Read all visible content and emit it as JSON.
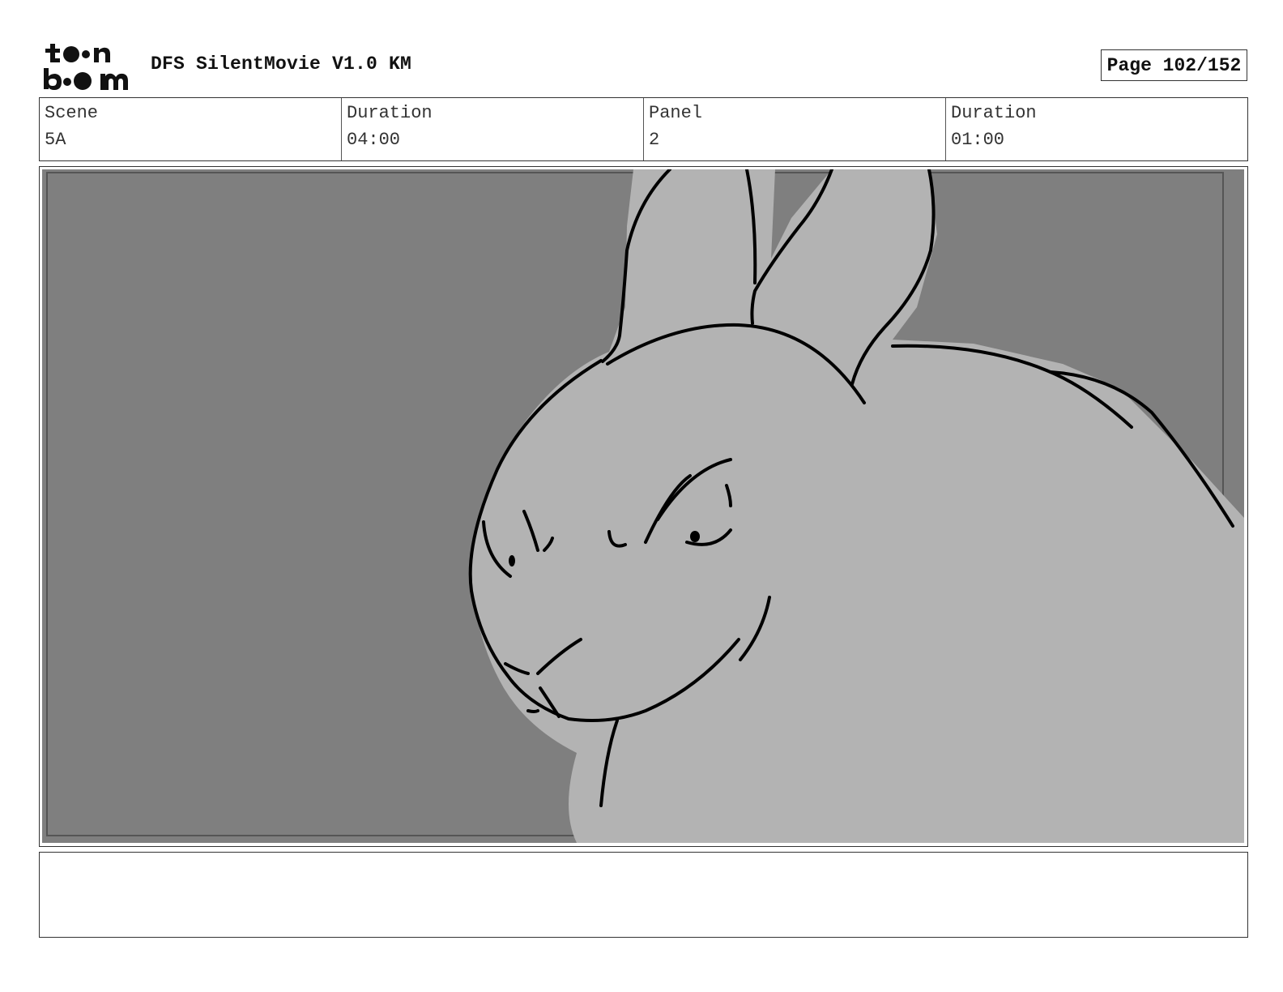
{
  "logo": {
    "line1": "toon",
    "line2": "boom",
    "icon": "toon-boom-logo"
  },
  "project_title": "DFS SilentMovie V1.0 KM",
  "page_label": "Page 102/152",
  "info": {
    "scene_label": "Scene",
    "scene_value": "5A",
    "scene_duration_label": "Duration",
    "scene_duration_value": "04:00",
    "panel_label": "Panel",
    "panel_value": "2",
    "panel_duration_label": "Duration",
    "panel_duration_value": "01:00"
  },
  "panel": {
    "image": "rabbit-sketch",
    "background_color": "#7f7f7f",
    "fill_color": "#b3b3b3",
    "line_color": "#000000"
  },
  "notes": ""
}
